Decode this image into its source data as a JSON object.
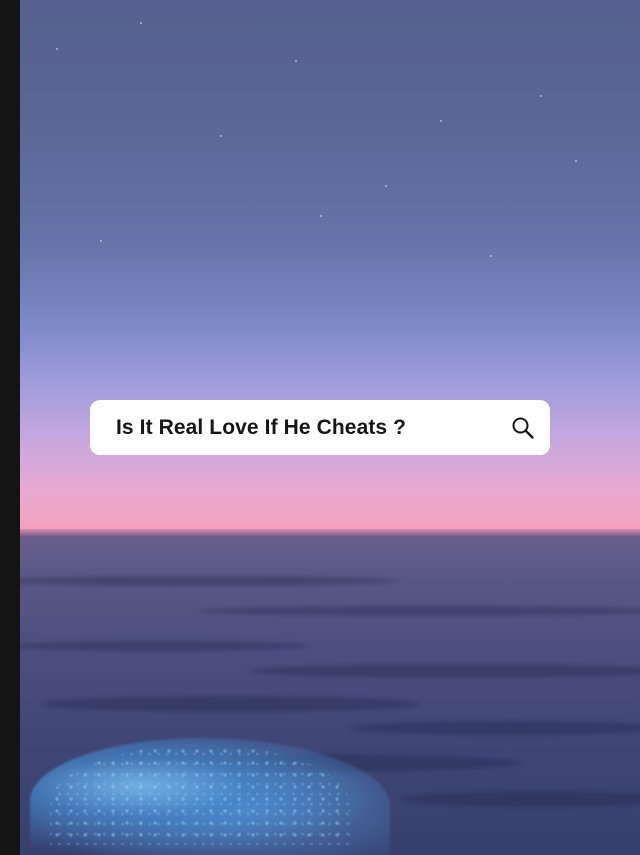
{
  "search": {
    "query": "Is It Real Love If He Cheats ?",
    "icon": "search-icon"
  },
  "colors": {
    "sky_top": "#55608f",
    "sky_horizon": "#f39cb9",
    "sea": "#414878",
    "foam": "#78bef0",
    "search_bar_bg": "#ffffff",
    "search_text": "#161616"
  }
}
